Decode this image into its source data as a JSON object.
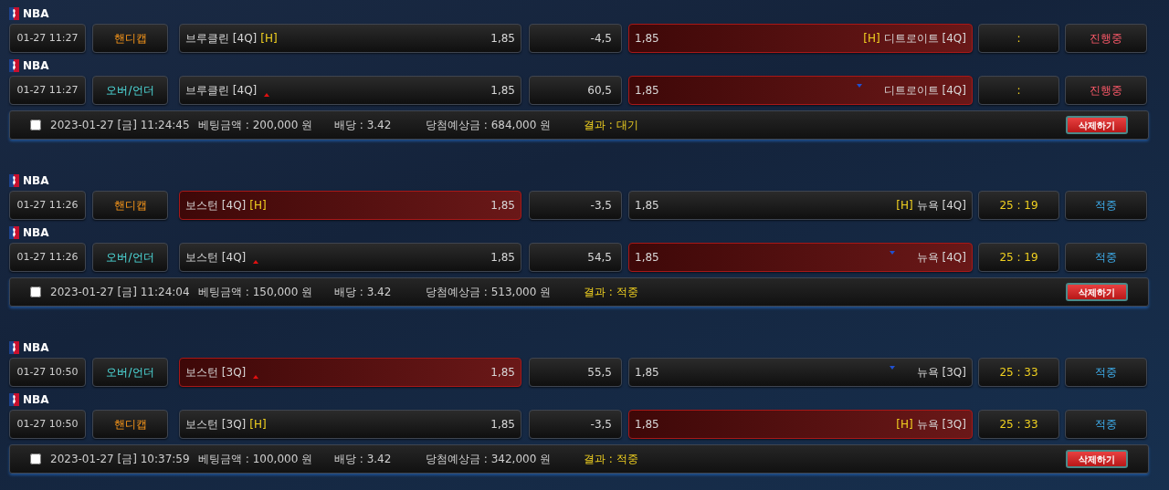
{
  "groups": [
    {
      "bets": [
        {
          "league": "NBA",
          "time": "01-27 11:27",
          "type": {
            "kind": "handicap",
            "label": "핸디캡"
          },
          "home": {
            "name": "브루클린 [4Q]",
            "tag": "[H]",
            "odds": "1,85",
            "selected": false
          },
          "line": "-4,5",
          "away": {
            "name": "디트로이트 [4Q]",
            "tag": "[H]",
            "odds": "1,85",
            "selected": true
          },
          "score": ":",
          "status": {
            "kind": "in_progress",
            "label": "진행중"
          }
        },
        {
          "league": "NBA",
          "time": "01-27 11:27",
          "type": {
            "kind": "over_under",
            "label": "오버/언더"
          },
          "home": {
            "name": "브루클린 [4Q]",
            "odds": "1,85",
            "selected": false
          },
          "line": "60,5",
          "away": {
            "name": "디트로이트 [4Q]",
            "odds": "1,85",
            "selected": true
          },
          "score": ":",
          "status": {
            "kind": "in_progress",
            "label": "진행중"
          }
        }
      ],
      "summary": {
        "checked": false,
        "datetime": "2023-01-27 [금] 11:24:45",
        "amount": "베팅금액 : 200,000 원",
        "rate": "배당 : 3.42",
        "payout": "당첨예상금 : 684,000 원",
        "result": "결과 : 대기",
        "delete": "삭제하기"
      }
    },
    {
      "bets": [
        {
          "league": "NBA",
          "time": "01-27 11:26",
          "type": {
            "kind": "handicap",
            "label": "핸디캡"
          },
          "home": {
            "name": "보스턴 [4Q]",
            "tag": "[H]",
            "odds": "1,85",
            "selected": true
          },
          "line": "-3,5",
          "away": {
            "name": "뉴욕 [4Q]",
            "tag": "[H]",
            "odds": "1,85",
            "selected": false
          },
          "score": "25 : 19",
          "status": {
            "kind": "won",
            "label": "적중"
          }
        },
        {
          "league": "NBA",
          "time": "01-27 11:26",
          "type": {
            "kind": "over_under",
            "label": "오버/언더"
          },
          "home": {
            "name": "보스턴 [4Q]",
            "odds": "1,85",
            "selected": false
          },
          "line": "54,5",
          "away": {
            "name": "뉴욕 [4Q]",
            "odds": "1,85",
            "selected": true
          },
          "score": "25 : 19",
          "status": {
            "kind": "won",
            "label": "적중"
          }
        }
      ],
      "summary": {
        "checked": false,
        "datetime": "2023-01-27 [금] 11:24:04",
        "amount": "베팅금액 : 150,000 원",
        "rate": "배당 : 3.42",
        "payout": "당첨예상금 : 513,000 원",
        "result": "결과 : 적중",
        "delete": "삭제하기"
      }
    },
    {
      "bets": [
        {
          "league": "NBA",
          "time": "01-27 10:50",
          "type": {
            "kind": "over_under",
            "label": "오버/언더"
          },
          "home": {
            "name": "보스턴 [3Q]",
            "odds": "1,85",
            "selected": true
          },
          "line": "55,5",
          "away": {
            "name": "뉴욕 [3Q]",
            "odds": "1,85",
            "selected": false
          },
          "score": "25 : 33",
          "status": {
            "kind": "won",
            "label": "적중"
          }
        },
        {
          "league": "NBA",
          "time": "01-27 10:50",
          "type": {
            "kind": "handicap",
            "label": "핸디캡"
          },
          "home": {
            "name": "보스턴 [3Q]",
            "tag": "[H]",
            "odds": "1,85",
            "selected": false
          },
          "line": "-3,5",
          "away": {
            "name": "뉴욕 [3Q]",
            "tag": "[H]",
            "odds": "1,85",
            "selected": true
          },
          "score": "25 : 33",
          "status": {
            "kind": "won",
            "label": "적중"
          }
        }
      ],
      "summary": {
        "checked": false,
        "datetime": "2023-01-27 [금] 10:37:59",
        "amount": "베팅금액 : 100,000 원",
        "rate": "배당 : 3.42",
        "payout": "당첨예상금 : 342,000 원",
        "result": "결과 : 적중",
        "delete": "삭제하기"
      }
    }
  ]
}
